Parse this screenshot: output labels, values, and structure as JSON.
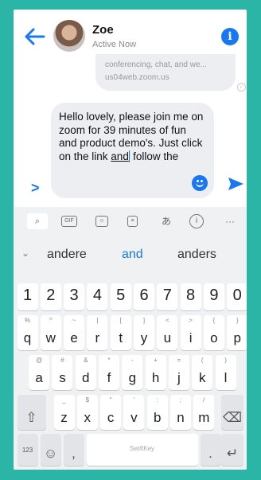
{
  "header": {
    "name": "Zoe",
    "status": "Active Now"
  },
  "messages": {
    "received_lines": [
      "conferencing, chat, and we...",
      "us04web.zoom.us"
    ]
  },
  "composer": {
    "text_before": "Hello lovely, please join me on zoom for 39 minutes of fun and product demo's. Just click on the link ",
    "text_underlined": "and",
    "text_after": " follow the"
  },
  "keyboard": {
    "toolbar": {
      "gif_label": "GIF"
    },
    "suggestions": [
      "andere",
      "and",
      "anders"
    ],
    "row_numbers": [
      "1",
      "2",
      "3",
      "4",
      "5",
      "6",
      "7",
      "8",
      "9",
      "0"
    ],
    "row1": [
      {
        "main": "q",
        "sub": "%"
      },
      {
        "main": "w",
        "sub": "^"
      },
      {
        "main": "e",
        "sub": "~"
      },
      {
        "main": "r",
        "sub": "|"
      },
      {
        "main": "t",
        "sub": "["
      },
      {
        "main": "y",
        "sub": "]"
      },
      {
        "main": "u",
        "sub": "<"
      },
      {
        "main": "i",
        "sub": ">"
      },
      {
        "main": "o",
        "sub": "{"
      },
      {
        "main": "p",
        "sub": "}"
      }
    ],
    "row2": [
      {
        "main": "a",
        "sub": "@"
      },
      {
        "main": "s",
        "sub": "#"
      },
      {
        "main": "d",
        "sub": "&"
      },
      {
        "main": "f",
        "sub": "*"
      },
      {
        "main": "g",
        "sub": "-"
      },
      {
        "main": "h",
        "sub": "+"
      },
      {
        "main": "j",
        "sub": "="
      },
      {
        "main": "k",
        "sub": "("
      },
      {
        "main": "l",
        "sub": ")"
      }
    ],
    "row3": [
      {
        "main": "z",
        "sub": "_"
      },
      {
        "main": "x",
        "sub": "$"
      },
      {
        "main": "c",
        "sub": "\""
      },
      {
        "main": "v",
        "sub": "'"
      },
      {
        "main": "b",
        "sub": ":"
      },
      {
        "main": "n",
        "sub": ";"
      },
      {
        "main": "m",
        "sub": "/"
      }
    ],
    "bottom": {
      "sym_label": "123",
      "space_logo": "SwiftKey",
      "period": ".",
      "comma": ","
    }
  }
}
